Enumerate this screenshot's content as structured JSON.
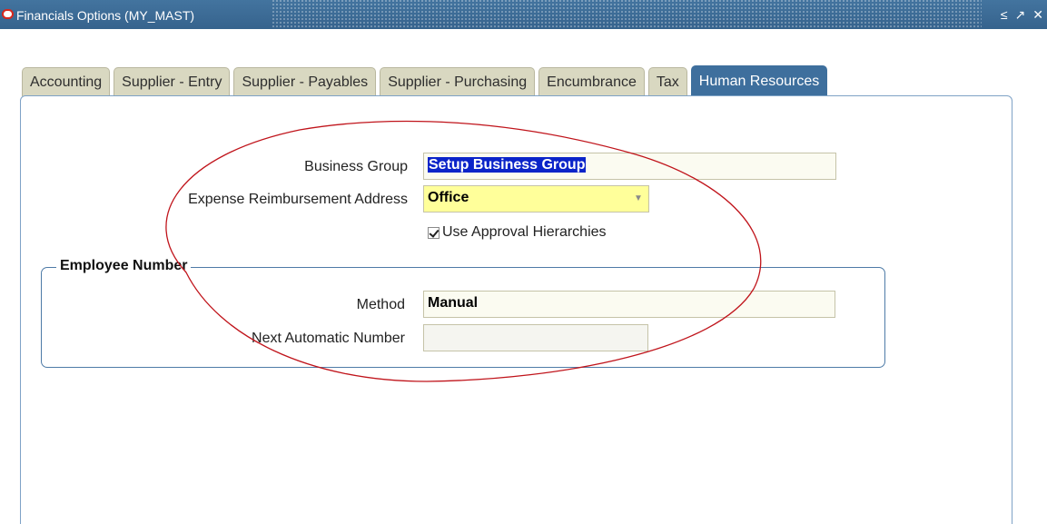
{
  "window": {
    "title": "Financials Options (MY_MAST)",
    "controls": {
      "minimize": "≤",
      "maximize": "↗",
      "close": "✕"
    }
  },
  "tabs": [
    {
      "label": "Accounting",
      "active": false
    },
    {
      "label": "Supplier - Entry",
      "active": false
    },
    {
      "label": "Supplier - Payables",
      "active": false
    },
    {
      "label": "Supplier - Purchasing",
      "active": false
    },
    {
      "label": "Encumbrance",
      "active": false
    },
    {
      "label": "Tax",
      "active": false
    },
    {
      "label": "Human Resources",
      "active": true
    }
  ],
  "form": {
    "business_group_label": "Business Group",
    "business_group_value": "Setup Business Group",
    "expense_address_label": "Expense Reimbursement Address",
    "expense_address_value": "Office",
    "use_approval_label": "Use Approval Hierarchies",
    "use_approval_checked": true
  },
  "employee_number": {
    "legend": "Employee Number",
    "method_label": "Method",
    "method_value": "Manual",
    "next_number_label": "Next Automatic Number",
    "next_number_value": ""
  },
  "colors": {
    "titlebar": "#3d6d99",
    "active_tab": "#3e6f9d",
    "inactive_tab": "#d9d8c1",
    "annotation_circle": "#c0141b",
    "selection": "#0b24c9",
    "required_field": "#ffff9a"
  },
  "icons": {
    "logo": "oracle-logo-icon",
    "dropdown": "chevron-down-icon",
    "check": "checkmark-icon"
  }
}
